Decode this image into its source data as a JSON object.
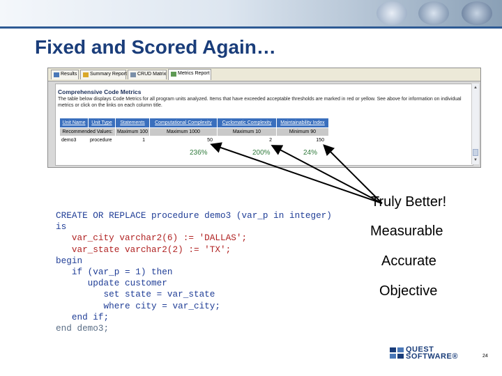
{
  "slide": {
    "title": "Fixed and Scored Again…",
    "page_number": "24",
    "colors": {
      "title": "#1a3d7a",
      "header_blue": "#3a6fbd",
      "percent_green": "#2f7a3b",
      "code_blue": "#1f3d96",
      "string_red": "#b02222"
    }
  },
  "screenshot": {
    "tabs": [
      {
        "label": "Results",
        "icon": "results-icon"
      },
      {
        "label": "Summary Report",
        "icon": "summary-icon"
      },
      {
        "label": "CRUD Matrix",
        "icon": "grid-icon"
      },
      {
        "label": "Metrics Report",
        "icon": "metrics-icon",
        "active": true
      }
    ],
    "report_title": "Comprehensive Code Metrics",
    "report_desc": "The table below displays Code Metrics for all program units analyzed. Items that have exceeded acceptable thresholds are marked in red or yellow. See above for information on individual metrics or click on the links on each column title.",
    "columns": [
      "Unit Name",
      "Unit Type",
      "Statements",
      "Computational Complexity",
      "Cyclomatic Complexity",
      "Maintainability Index"
    ],
    "recommended": [
      "Recommended Values:",
      "Maximum 100",
      "Maximum 1000",
      "Maximum 10",
      "Minimum 90"
    ],
    "row": [
      "demo3",
      "procedure",
      "1",
      "50",
      "2",
      "150"
    ]
  },
  "percentages": [
    "236%",
    "200%",
    "24%"
  ],
  "code_lines": [
    "CREATE OR REPLACE procedure demo3 (var_p in integer)",
    "is",
    "   var_city varchar2(6) := 'DALLAS';",
    "   var_state varchar2(2) := 'TX';",
    "begin",
    "   if (var_p = 1) then",
    "      update customer",
    "         set state = var_state",
    "         where city = var_city;",
    "   end if;",
    "end demo3;"
  ],
  "bullets": [
    "Truly Better!",
    "Measurable",
    "Accurate",
    "Objective"
  ],
  "logo": {
    "line1": "QUEST",
    "line2": "SOFTWARE®"
  }
}
